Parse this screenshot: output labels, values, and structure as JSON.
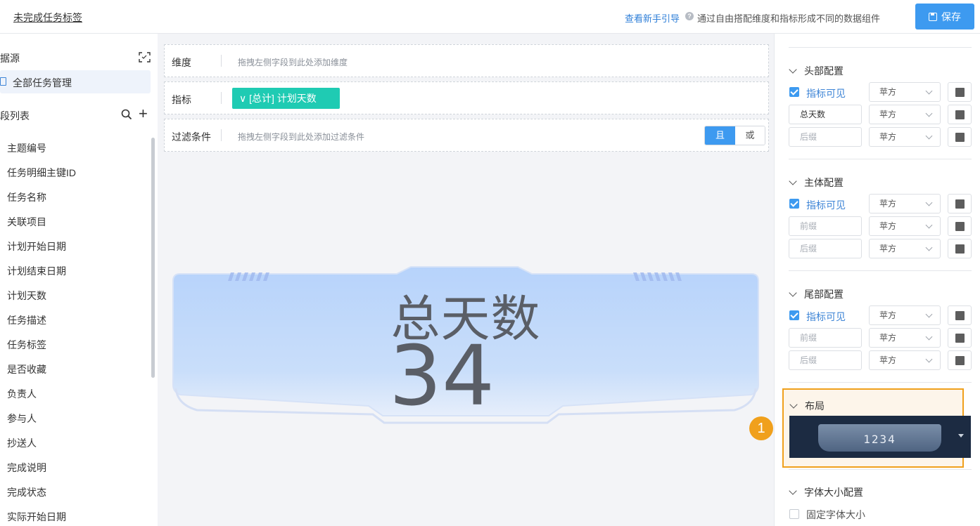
{
  "header": {
    "title": "未完成任务标签",
    "guide_link": "查看新手引导",
    "guide_desc": "通过自由搭配维度和指标形成不同的数据组件",
    "save_label": "保存"
  },
  "sidebar": {
    "datasource_title": "据源",
    "datasource_item": "全部任务管理",
    "fields_title": "段列表",
    "fields": [
      "主题编号",
      "任务明细主键ID",
      "任务名称",
      "关联项目",
      "计划开始日期",
      "计划结束日期",
      "计划天数",
      "任务描述",
      "任务标签",
      "是否收藏",
      "负责人",
      "参与人",
      "抄送人",
      "完成说明",
      "完成状态",
      "实际开始日期"
    ]
  },
  "conditions": {
    "dimension_label": "维度",
    "dimension_placeholder": "拖拽左侧字段到此处添加维度",
    "metric_label": "指标",
    "metric_chip": "[总计] 计划天数",
    "filter_label": "过滤条件",
    "filter_placeholder": "拖拽左侧字段到此处添加过滤条件",
    "logic_and": "且",
    "logic_or": "或"
  },
  "card": {
    "label": "总天数",
    "value": "34"
  },
  "panel": {
    "header_section": {
      "title": "头部配置",
      "visible_label": "指标可见",
      "font": "苹方",
      "input1": "总天数",
      "input2_placeholder": "后缀"
    },
    "body_section": {
      "title": "主体配置",
      "visible_label": "指标可见",
      "font": "苹方",
      "input1_placeholder": "前缀",
      "input2_placeholder": "后缀"
    },
    "footer_section": {
      "title": "尾部配置",
      "visible_label": "指标可见",
      "font": "苹方",
      "input1_placeholder": "前缀",
      "input2_placeholder": "后缀"
    },
    "layout_section": {
      "title": "布局",
      "preview_value": "1234"
    },
    "font_size_section": {
      "title": "字体大小配置",
      "fixed_label": "固定字体大小"
    },
    "step_badge": "1"
  },
  "colors": {
    "accent": "#3d9af0",
    "metric_chip": "#1fcbb3",
    "highlight": "#f0a01c",
    "swatch": "#5d5d5d"
  }
}
